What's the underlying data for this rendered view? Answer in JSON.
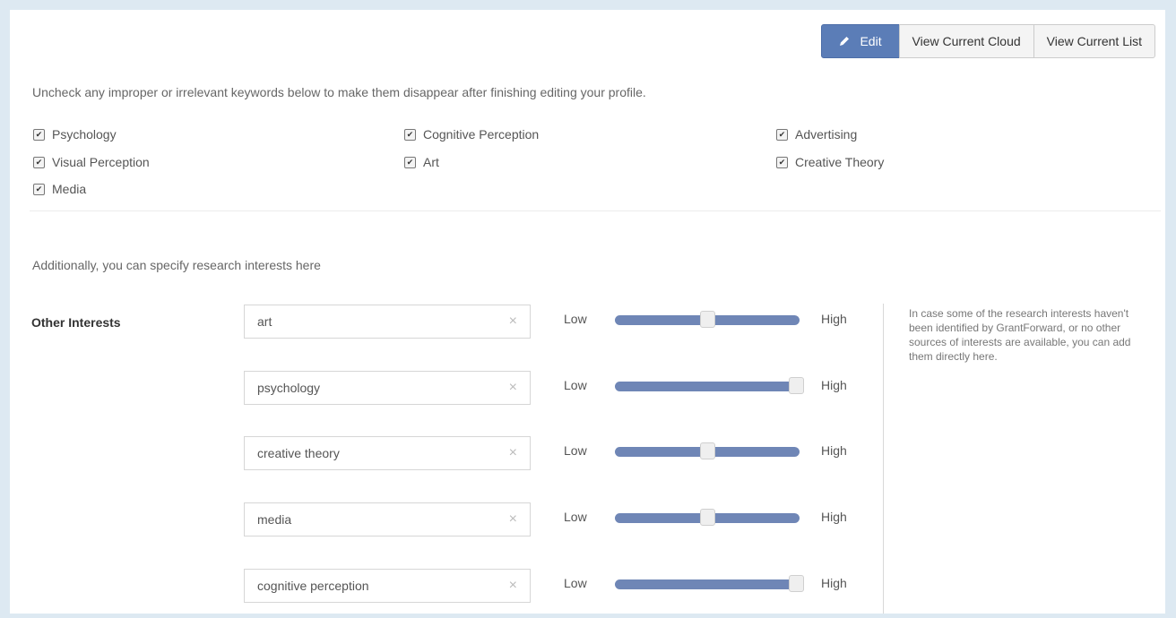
{
  "toolbar": {
    "edit_label": "Edit",
    "view_cloud_label": "View Current Cloud",
    "view_list_label": "View Current List"
  },
  "instructions": "Uncheck any improper or irrelevant keywords below to make them disappear after finishing editing your profile.",
  "keywords": [
    {
      "label": "Psychology",
      "checked": true
    },
    {
      "label": "Cognitive Perception",
      "checked": true
    },
    {
      "label": "Advertising",
      "checked": true
    },
    {
      "label": "Visual Perception",
      "checked": true
    },
    {
      "label": "Art",
      "checked": true
    },
    {
      "label": "Creative Theory",
      "checked": true
    },
    {
      "label": "Media",
      "checked": true
    }
  ],
  "additional_text": "Additionally, you can specify research interests here",
  "other_interests_label": "Other Interests",
  "interests": [
    {
      "value": "art",
      "level": 0.5
    },
    {
      "value": "psychology",
      "level": 1.0
    },
    {
      "value": "creative theory",
      "level": 0.5
    },
    {
      "value": "media",
      "level": 0.5
    },
    {
      "value": "cognitive perception",
      "level": 1.0
    }
  ],
  "slider": {
    "low_label": "Low",
    "high_label": "High",
    "clear_glyph": "×"
  },
  "help_text": "In case some of the research interests haven't been identified by GrantForward, or no other sources of interests are available, you can add them directly here.",
  "colors": {
    "accent": "#5b7db7",
    "slider_track": "#6f86b6"
  },
  "icons": {
    "edit": "pencil-icon",
    "check": "checkmark-icon",
    "clear": "clear-x-icon"
  }
}
